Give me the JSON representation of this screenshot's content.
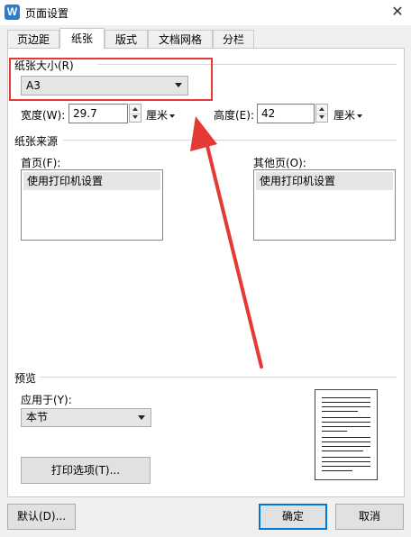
{
  "window": {
    "icon_letter": "W",
    "title": "页面设置",
    "close_symbol": "✕"
  },
  "tabs": [
    {
      "label": "页边距",
      "active": false
    },
    {
      "label": "纸张",
      "active": true
    },
    {
      "label": "版式",
      "active": false
    },
    {
      "label": "文档网格",
      "active": false
    },
    {
      "label": "分栏",
      "active": false
    }
  ],
  "paper_size": {
    "group_label": "纸张大小(R)",
    "selected": "A3",
    "width_label": "宽度(W):",
    "width_value": "29.7",
    "width_unit": "厘米",
    "height_label": "高度(E):",
    "height_value": "42",
    "height_unit": "厘米"
  },
  "paper_source": {
    "group_label": "纸张来源",
    "first_page_label": "首页(F):",
    "first_page_items": [
      "使用打印机设置"
    ],
    "other_pages_label": "其他页(O):",
    "other_pages_items": [
      "使用打印机设置"
    ]
  },
  "preview": {
    "group_label": "预览",
    "apply_to_label": "应用于(Y):",
    "apply_to_value": "本节",
    "print_options_label": "打印选项(T)..."
  },
  "footer": {
    "default_label": "默认(D)...",
    "ok_label": "确定",
    "cancel_label": "取消"
  },
  "colors": {
    "annotation_red": "#e53935",
    "app_blue": "#2b7cd3",
    "primary_border": "#0078d7"
  }
}
